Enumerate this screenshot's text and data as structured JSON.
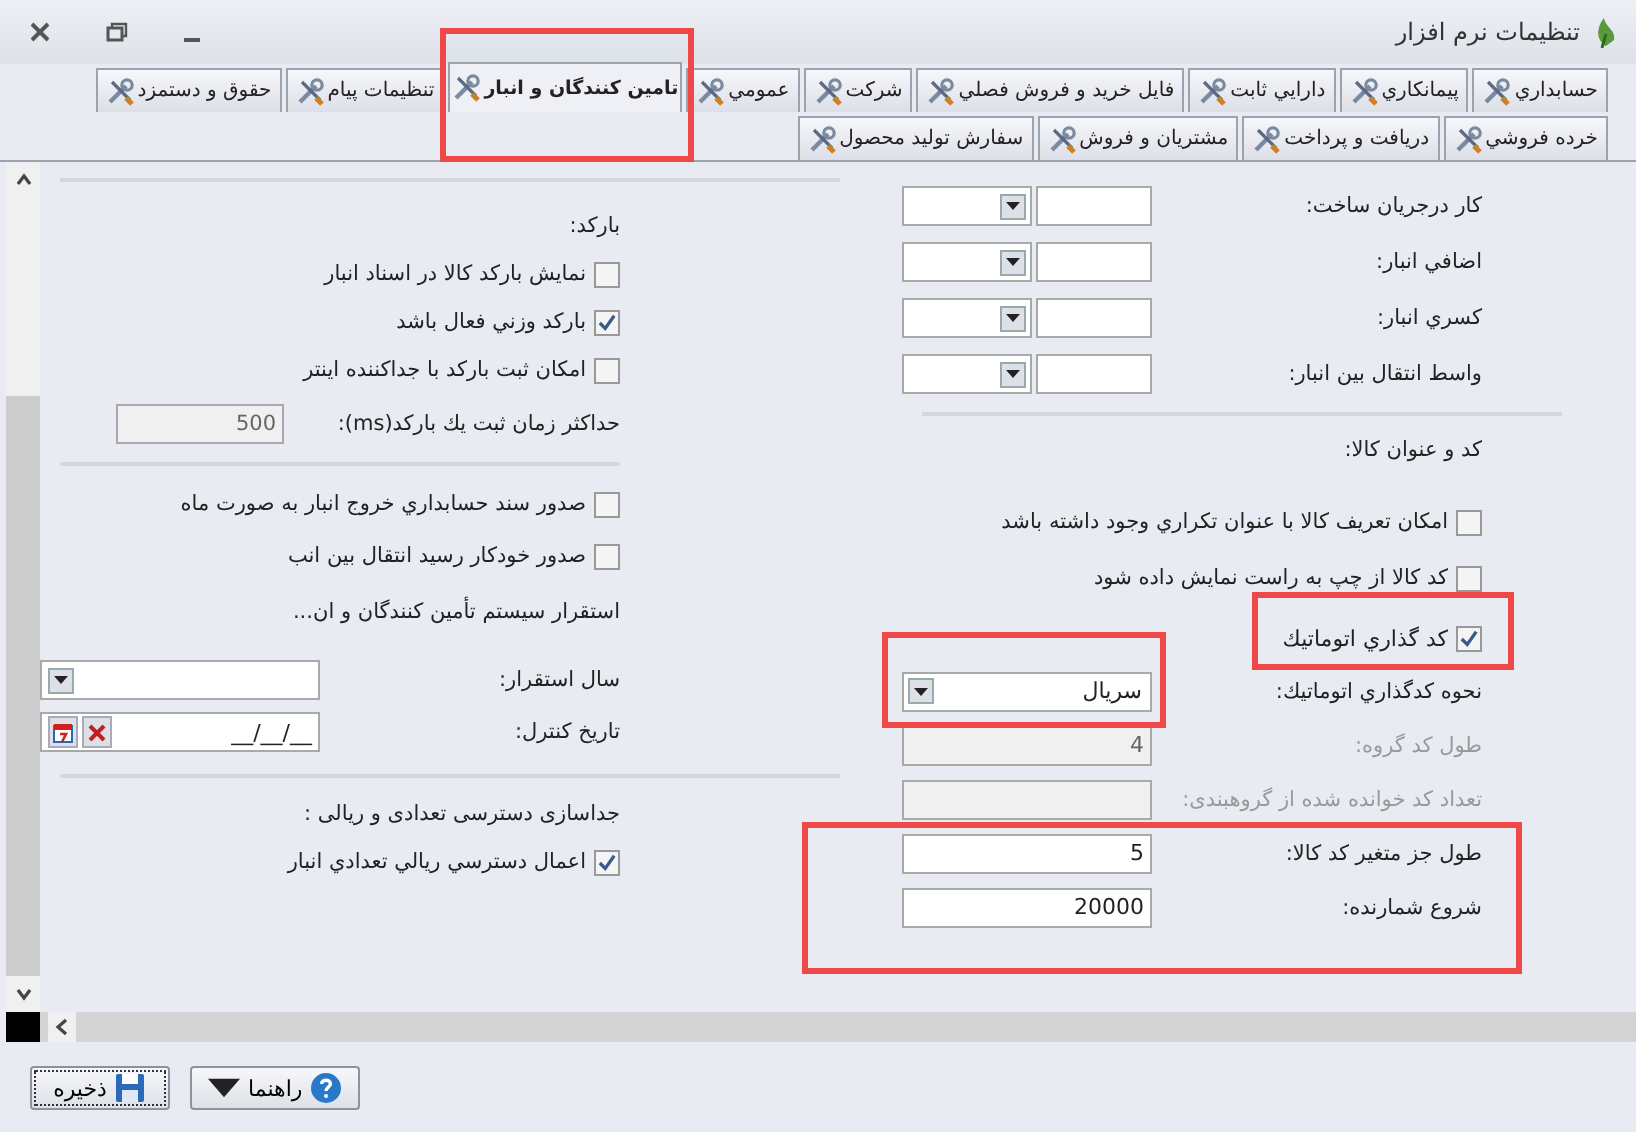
{
  "window": {
    "title": "تنظيمات نرم افزار"
  },
  "tab_rows": [
    {
      "tabs": [
        {
          "label": "حسابداري",
          "selected": false
        },
        {
          "label": "پيمانكاري",
          "selected": false
        },
        {
          "label": "دارايي ثابت",
          "selected": false
        },
        {
          "label": "فايل خريد و فروش فصلي",
          "selected": false
        },
        {
          "label": "شركت",
          "selected": false
        },
        {
          "label": "عمومي",
          "selected": false
        },
        {
          "label": "تامين كنندگان و انبار",
          "selected": true
        },
        {
          "label": "تنظيمات پيام",
          "selected": false
        },
        {
          "label": "حقوق و دستمزد",
          "selected": false
        }
      ]
    },
    {
      "tabs": [
        {
          "label": "خرده فروشي",
          "selected": false
        },
        {
          "label": "دريافت و پرداخت",
          "selected": false
        },
        {
          "label": "مشتريان و فروش",
          "selected": false
        },
        {
          "label": "سفارش توليد محصول",
          "selected": false
        }
      ]
    }
  ],
  "accounts": [
    {
      "label": "كار درجريان ساخت:"
    },
    {
      "label": "اضافي انبار:"
    },
    {
      "label": "كسري انبار:"
    },
    {
      "label": "واسط انتقال بين انبار:"
    }
  ],
  "item_code": {
    "heading": "كد و عنوان كالا:",
    "checkboxes": [
      {
        "label": "امكان تعريف كالا با عنوان تكراري وجود داشته باشد",
        "checked": false
      },
      {
        "label": "كد كالا از چپ به راست نمايش داده شود",
        "checked": false
      }
    ],
    "auto": {
      "label": "كد گذاري اتوماتيك",
      "checked": true
    },
    "method": {
      "label": "نحوه كدگذاري اتوماتيك:",
      "value": "سريال"
    },
    "fields": [
      {
        "label": "طول كد گروه:",
        "value": "4",
        "disabled": true
      },
      {
        "label": "تعداد كد خوانده شده از گروهبندی:",
        "disabled": true
      },
      {
        "label": "طول جز متغير كد كالا:",
        "value": "5",
        "disabled": false
      },
      {
        "label": "شروع شمارنده:",
        "value": "20000",
        "disabled": false
      }
    ]
  },
  "barcode": {
    "heading": "باركد:",
    "checkboxes": [
      {
        "label": "نمايش باركد كالا در اسناد انبار",
        "checked": false
      },
      {
        "label": "باركد وزني فعال باشد",
        "checked": true
      },
      {
        "label": "امكان ثبت باركد با جداكننده اينتر",
        "checked": false
      }
    ],
    "max_time": {
      "label": "حداكثر زمان ثبت يك باركد(ms):",
      "value": "500",
      "disabled": true
    }
  },
  "warehouse_checkboxes": [
    {
      "label": "صدور سند حسابداري خروج انبار به صورت ماه",
      "checked": false
    },
    {
      "label": "صدور خودكار رسيد انتقال بين انب",
      "checked": false
    }
  ],
  "deployment": {
    "heading": "استقرار سيستم تأمين كنندگان و ان...",
    "year": {
      "label": "سال استقرار:"
    },
    "control_date": {
      "label": "تاريخ كنترل:",
      "value": "__/__/__"
    }
  },
  "access": {
    "heading": "جداسازی دسترسی تعدادی و ریالی :",
    "checkbox": {
      "label": "اعمال دسترسي ريالي تعدادي انبار",
      "checked": true
    }
  },
  "buttons": [
    {
      "kind": "help",
      "label": "راهنما"
    },
    {
      "kind": "save",
      "label": "ذخيره"
    }
  ]
}
